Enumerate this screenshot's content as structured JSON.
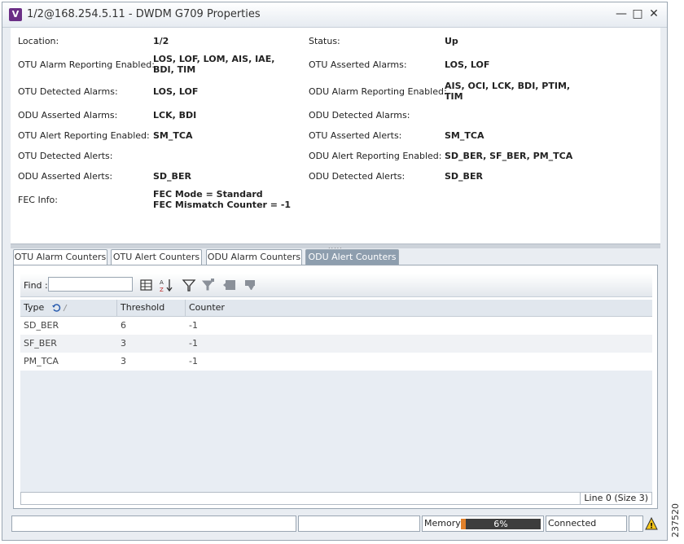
{
  "window": {
    "title": "1/2@168.254.5.11 - DWDM G709 Properties",
    "app_icon_letter": "V",
    "minimize_glyph": "—",
    "maximize_glyph": "□",
    "close_glyph": "✕"
  },
  "properties": {
    "location_label": "Location:",
    "location_value": "1/2",
    "status_label": "Status:",
    "status_value": "Up",
    "otu_alarm_reporting_label": "OTU Alarm Reporting Enabled:",
    "otu_alarm_reporting_value": "LOS, LOF, LOM, AIS, IAE,\nBDI, TIM",
    "otu_asserted_alarms_label": "OTU Asserted Alarms:",
    "otu_asserted_alarms_value": "LOS, LOF",
    "otu_detected_alarms_label": "OTU Detected Alarms:",
    "otu_detected_alarms_value": "LOS, LOF",
    "odu_alarm_reporting_label": "ODU Alarm Reporting Enabled:",
    "odu_alarm_reporting_value": "AIS, OCI, LCK, BDI, PTIM,\nTIM",
    "odu_asserted_alarms_label": "ODU Asserted Alarms:",
    "odu_asserted_alarms_value": "LCK, BDI",
    "odu_detected_alarms_label": "ODU Detected Alarms:",
    "odu_detected_alarms_value": "",
    "otu_alert_reporting_label": "OTU Alert Reporting Enabled:",
    "otu_alert_reporting_value": "SM_TCA",
    "otu_asserted_alerts_label": "OTU Asserted Alerts:",
    "otu_asserted_alerts_value": "SM_TCA",
    "otu_detected_alerts_label": "OTU Detected Alerts:",
    "otu_detected_alerts_value": "",
    "odu_alert_reporting_label": "ODU Alert Reporting Enabled:",
    "odu_alert_reporting_value": "SD_BER, SF_BER, PM_TCA",
    "odu_asserted_alerts_label": "ODU Asserted Alerts:",
    "odu_asserted_alerts_value": "SD_BER",
    "odu_detected_alerts_label": "ODU Detected Alerts:",
    "odu_detected_alerts_value": "SD_BER",
    "fec_info_label": "FEC Info:",
    "fec_info_value": "FEC Mode = Standard\nFEC Mismatch Counter = -1"
  },
  "splitter_grip": ".....",
  "tabs": [
    "OTU Alarm Counters",
    "OTU Alert Counters",
    "ODU Alarm Counters",
    "ODU Alert Counters"
  ],
  "active_tab": "ODU Alert Counters",
  "toolbar": {
    "find_label": "Find :",
    "find_value": "",
    "sort_asc_glyph": "↑",
    "sort_desc_glyph": "↓"
  },
  "table": {
    "columns": [
      "Type",
      "Threshold",
      "Counter"
    ],
    "rows": [
      [
        "SD_BER",
        "6",
        "-1"
      ],
      [
        "SF_BER",
        "3",
        "-1"
      ],
      [
        "PM_TCA",
        "3",
        "-1"
      ]
    ],
    "line_info": "Line 0 (Size 3)"
  },
  "statusbar": {
    "memory_label": "Memory:",
    "memory_value": "6%",
    "memory_fraction": 0.06,
    "connection": "Connected",
    "warning_glyph": "!"
  },
  "side_code": "237520",
  "colors": {
    "accent": "#6b2f86",
    "active_tab": "#8e9eae",
    "memory_fill": "#e0802a"
  }
}
